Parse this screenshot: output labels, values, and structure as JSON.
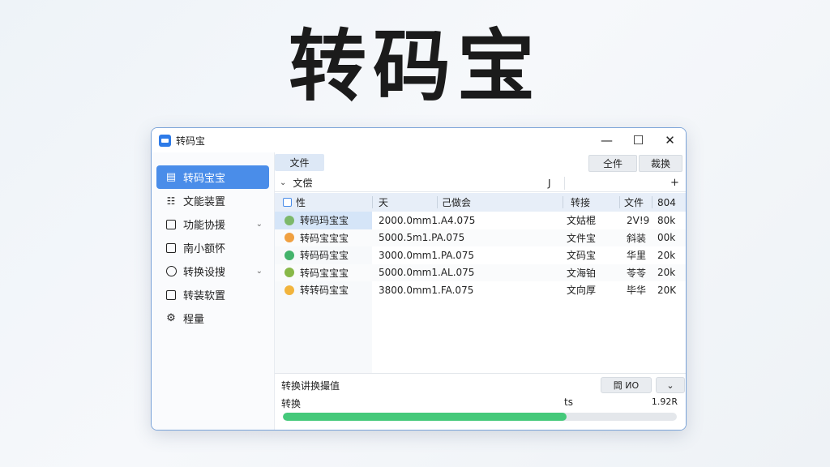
{
  "hero": {
    "title": "转码宝"
  },
  "window": {
    "title": "转码宝",
    "controls": {
      "minimize": "—",
      "maximize": "☐",
      "close": "✕"
    }
  },
  "sidebar": {
    "items": [
      {
        "label": "转码宝宝",
        "icon": "doc-icon",
        "active": true,
        "chevron": ""
      },
      {
        "label": "文能装置",
        "icon": "grid-icon",
        "active": false,
        "chevron": ""
      },
      {
        "label": "功能协援",
        "icon": "box-icon",
        "active": false,
        "chevron": "⌄"
      },
      {
        "label": "南小额怀",
        "icon": "box-icon",
        "active": false,
        "chevron": ""
      },
      {
        "label": "转换设搜",
        "icon": "clock-icon",
        "active": false,
        "chevron": "⌄"
      },
      {
        "label": "转装软置",
        "icon": "box-icon",
        "active": false,
        "chevron": ""
      },
      {
        "label": "程量",
        "icon": "gear-icon",
        "active": false,
        "chevron": ""
      }
    ]
  },
  "toolbar": {
    "file_tab": "文件",
    "btn1": "仝件",
    "btn2": "裁换"
  },
  "pathbar": {
    "chevron": "⌄",
    "text": "文偿",
    "j": "J",
    "plus": "+"
  },
  "table": {
    "headers": {
      "name": "性",
      "c2": "天",
      "c3": "己做会",
      "c4": "转接",
      "c5": "文件",
      "c6": "804"
    },
    "rows": [
      {
        "name": "转码玛宝宝",
        "info": "2000.0mm1.A4.075",
        "type": "文姑棍",
        "status": "2V!9",
        "size": "80k",
        "icon_color": "#7cb86a"
      },
      {
        "name": "转码宝宝宝",
        "info": "5000.5m1.PA.075",
        "type": "文件宝",
        "status": "斜装",
        "size": "00k",
        "icon_color": "#f0a040"
      },
      {
        "name": "转码码宝宝",
        "info": "3000.0mm1.PA.075",
        "type": "文码宝",
        "status": "华里",
        "size": "20k",
        "icon_color": "#43b36b"
      },
      {
        "name": "转码宝宝宝",
        "info": "5000.0mm1.AL.075",
        "type": "文海铂",
        "status": "苓苓",
        "size": "20k",
        "icon_color": "#88b848"
      },
      {
        "name": "转转码宝宝",
        "info": "3800.0mm1.FA.075",
        "type": "文向厚",
        "status": "毕华",
        "size": "20K",
        "icon_color": "#f2b43c"
      }
    ]
  },
  "bottom": {
    "status_label": "转换讲换撮值",
    "btn_a": "閊 ИO",
    "btn_b": "⌄",
    "progress_label": "转换",
    "progress_ts": "ts",
    "progress_size": "1.92R",
    "progress_fraction": 0.72
  },
  "colors": {
    "accent": "#4a8de9",
    "progress": "#45c97a"
  }
}
